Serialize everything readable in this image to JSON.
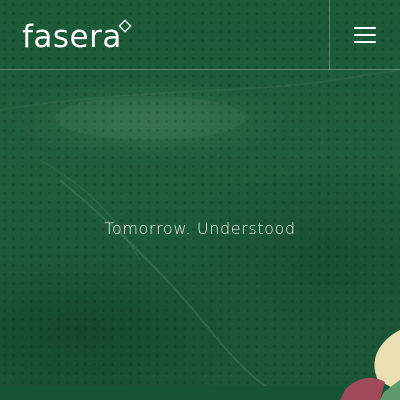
{
  "brand": {
    "name": "fasera",
    "diamond_icon": "diamond-outline-icon"
  },
  "header": {
    "menu_icon": "hamburger-menu-icon"
  },
  "hero": {
    "tagline": "Tomorrow. Understood"
  },
  "colors": {
    "background": "#1e5b3b",
    "text": "#ffffff",
    "accent_cream": "#e9dfb2",
    "accent_rose": "#a04a5a",
    "accent_green": "#5f9b6a"
  }
}
